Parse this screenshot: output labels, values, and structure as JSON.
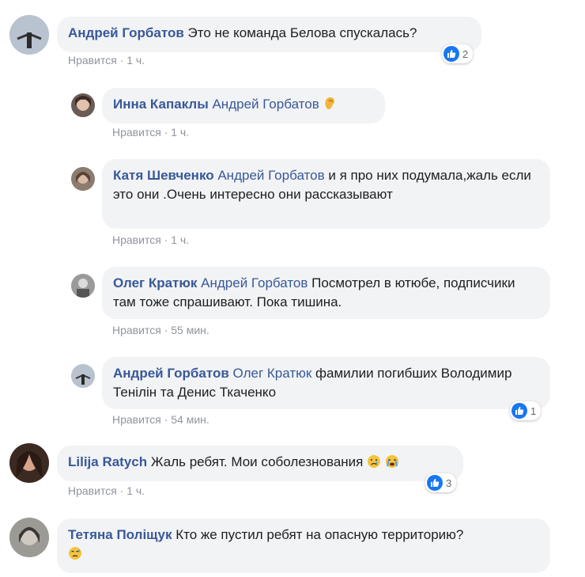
{
  "comments": [
    {
      "author": "Андрей Горбатов",
      "text": "Это не команда Белова спускалась?",
      "like": "Нравится",
      "time": "1 ч.",
      "reactions": "2"
    },
    {
      "author": "Инна Капаклы",
      "mention": "Андрей Горбатов",
      "text": "",
      "like": "Нравится",
      "time": "1 ч."
    },
    {
      "author": "Катя Шевченко",
      "mention": "Андрей Горбатов",
      "text": "и я про них подумала,жаль если это они .Очень интересно они рассказывают",
      "like": "Нравится",
      "time": "1 ч."
    },
    {
      "author": "Олег Кратюк",
      "mention": "Андрей Горбатов",
      "text": "Посмотрел в ютюбе, подписчики там тоже спрашивают. Пока тишина.",
      "like": "Нравится",
      "time": "55 мин."
    },
    {
      "author": "Андрей Горбатов",
      "mention": "Олег Кратюк",
      "text": "фамилии погибших Володимир Тенілін та Денис Ткаченко",
      "like": "Нравится",
      "time": "54 мин.",
      "reactions": "1"
    },
    {
      "author": "Lilija Ratych",
      "text": "Жаль ребят. Мои соболезнования",
      "like": "Нравится",
      "time": "1 ч.",
      "reactions": "3"
    },
    {
      "author": "Тетяна Поліщук",
      "text": "Кто же пустил ребят на опасную территорию?",
      "like": "",
      "time": ""
    }
  ],
  "separator": "·",
  "icons": {
    "like": "like-icon",
    "ear": "ear-emoji",
    "crying": "crying-emoji",
    "sad": "sad-emoji"
  }
}
